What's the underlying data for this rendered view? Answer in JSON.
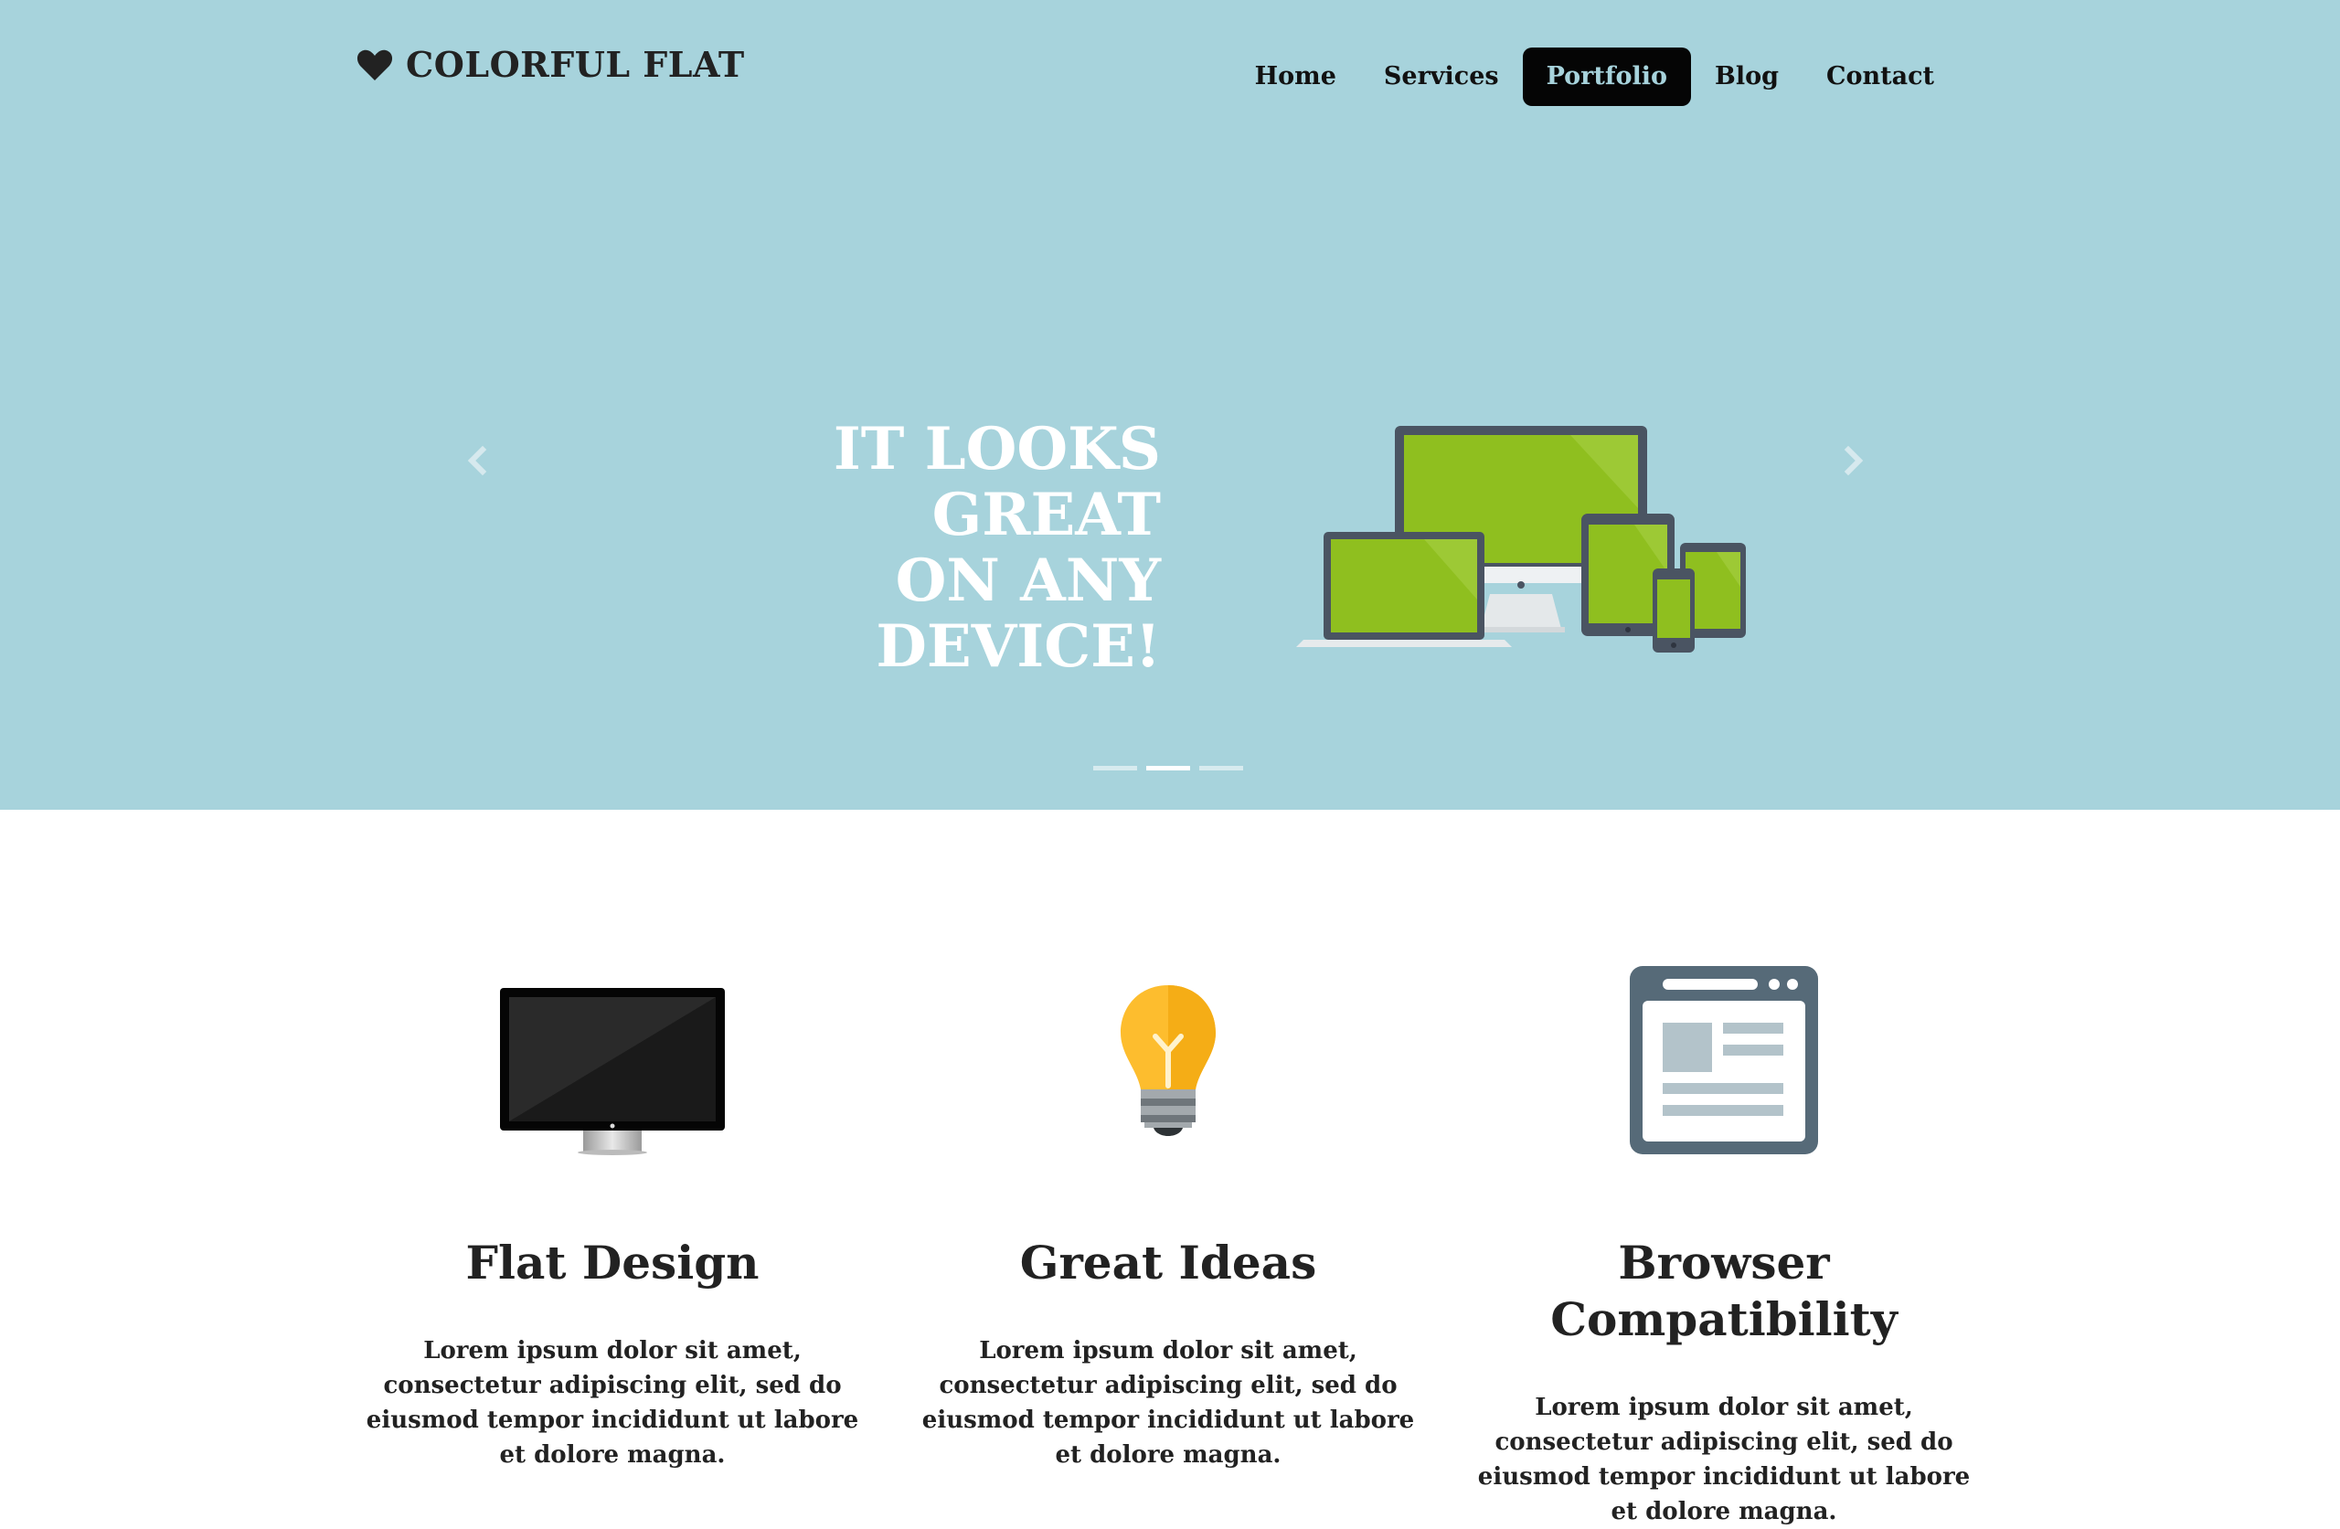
{
  "brand": {
    "name": "COLORFUL FLAT",
    "icon": "heart-icon"
  },
  "nav": {
    "items": [
      {
        "label": "Home",
        "active": false
      },
      {
        "label": "Services",
        "active": false
      },
      {
        "label": "Portfolio",
        "active": true
      },
      {
        "label": "Blog",
        "active": false
      },
      {
        "label": "Contact",
        "active": false
      }
    ]
  },
  "hero": {
    "heading_line1": "IT LOOKS GREAT",
    "heading_line2": "ON ANY DEVICE!",
    "slide_count": 3,
    "active_slide": 2,
    "colors": {
      "background": "#a7d3dc",
      "screen": "#8fbf1f",
      "frame": "#4a5462"
    }
  },
  "features": [
    {
      "icon": "monitor-icon",
      "title": "Flat Design",
      "text": "Lorem ipsum dolor sit amet, consectetur adipiscing elit, sed do eiusmod tempor incididunt ut labore et dolore magna."
    },
    {
      "icon": "lightbulb-icon",
      "title": "Great Ideas",
      "text": "Lorem ipsum dolor sit amet, consectetur adipiscing elit, sed do eiusmod tempor incididunt ut labore et dolore magna."
    },
    {
      "icon": "browser-window-icon",
      "title": "Browser Compatibility",
      "text": "Lorem ipsum dolor sit amet, consectetur adipiscing elit, sed do eiusmod tempor incididunt ut labore et dolore magna."
    }
  ]
}
